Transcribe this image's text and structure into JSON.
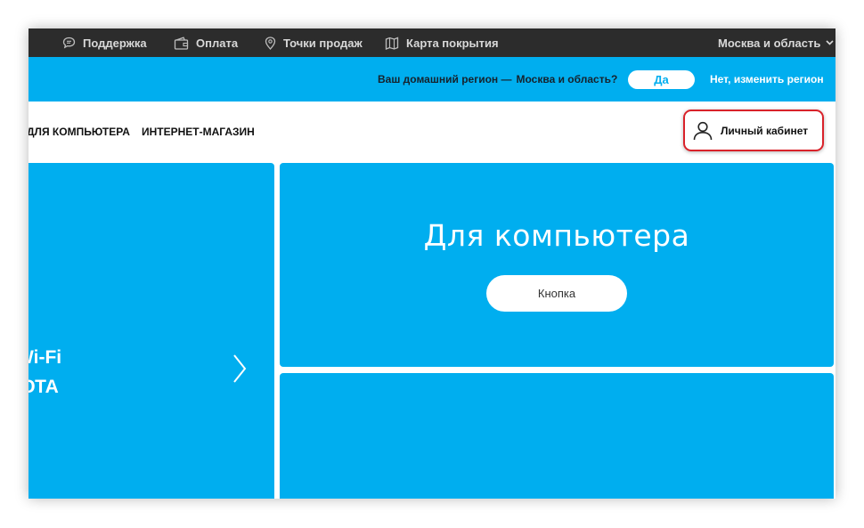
{
  "topbar": {
    "items": [
      {
        "label": "Поддержка",
        "icon": "chat-bubble-icon"
      },
      {
        "label": "Оплата",
        "icon": "wallet-icon"
      },
      {
        "label": "Точки продаж",
        "icon": "location-pin-icon"
      },
      {
        "label": "Карта покрытия",
        "icon": "map-icon"
      }
    ],
    "region_selector": "Москва и область",
    "region_chevron_icon": "chevron-down-icon"
  },
  "region_bar": {
    "question_prefix": "Ваш домашний регион —",
    "question_region": "Москва и область?",
    "yes_label": "Да",
    "change_label": "Нет, изменить регион"
  },
  "nav": {
    "links": [
      "ДЛЯ КОМПЬЮТЕРА",
      "ИНТЕРНЕТ-МАГАЗИН"
    ],
    "cabinet_label": "Личный кабинет",
    "cabinet_icon": "user-icon"
  },
  "main": {
    "left_card": {
      "line1": "Wi-Fi",
      "line2": "ЮТА",
      "arrow_icon": "chevron-right-icon"
    },
    "right_top_card": {
      "title": "Для компьютера",
      "button_label": "Кнопка"
    }
  },
  "colors": {
    "brand_blue": "#00aeef",
    "topbar_bg": "#2c2c2c",
    "highlight_red": "#d9222a"
  }
}
